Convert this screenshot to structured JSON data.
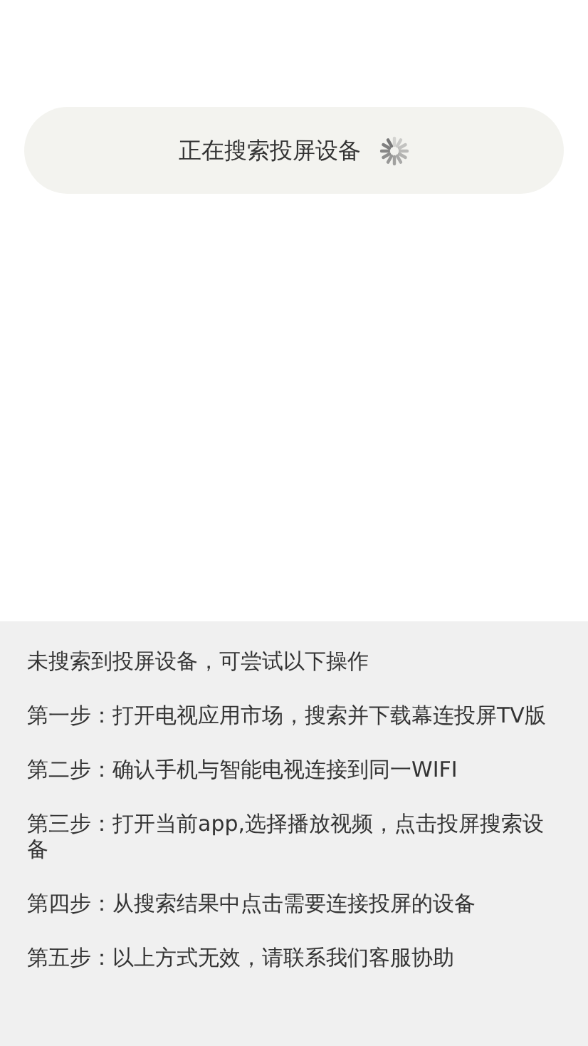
{
  "search_status": {
    "label": "正在搜索投屏设备"
  },
  "help": {
    "title": "未搜索到投屏设备，可尝试以下操作",
    "steps": [
      "第一步：打开电视应用市场，搜索并下载幕连投屏TV版",
      "第二步：确认手机与智能电视连接到同一WIFI",
      "第三步：打开当前app,选择播放视频，点击投屏搜索设备",
      "第四步：从搜索结果中点击需要连接投屏的设备",
      "第五步：以上方式无效，请联系我们客服协助"
    ]
  }
}
